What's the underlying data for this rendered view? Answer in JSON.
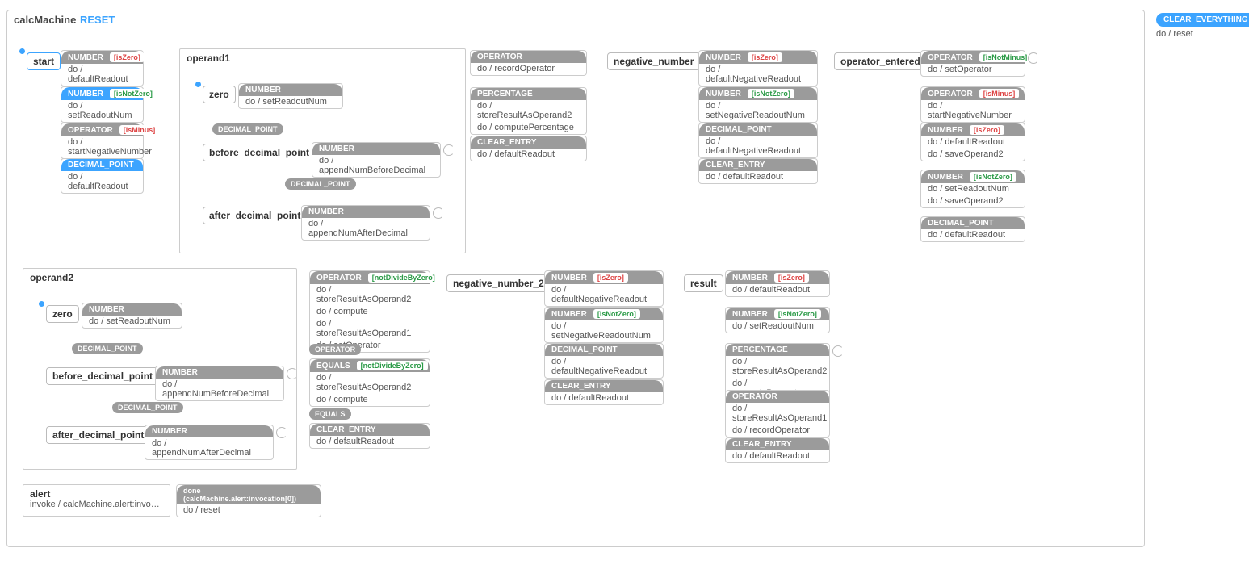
{
  "machine": {
    "title": "calcMachine",
    "reset": "RESET"
  },
  "global": {
    "clear": {
      "event": "CLEAR_EVERYTHING",
      "action": "do / reset"
    }
  },
  "states": {
    "start": "start",
    "operand1": "operand1",
    "operand2": "operand2",
    "negnum": "negative_number",
    "negnum2": "negative_number_2",
    "opent": "operator_entered",
    "result": "result",
    "alert": "alert",
    "zero": "zero",
    "bdp": "before_decimal_point",
    "adp": "after_decimal_point"
  },
  "ev": {
    "number": "NUMBER",
    "operator": "OPERATOR",
    "dp": "DECIMAL_POINT",
    "pct": "PERCENTAGE",
    "ce": "CLEAR_ENTRY",
    "eq": "EQUALS",
    "done": "done (calcMachine.alert:invocation[0])"
  },
  "guards": {
    "isZero": "[isZero]",
    "isNotZero": "[isNotZero]",
    "isMinus": "[isMinus]",
    "isNotMinus": "[isNotMinus]",
    "ndbz": "[notDivideByZero]"
  },
  "actions": {
    "defaultReadout": "do / defaultReadout",
    "setReadoutNum": "do / setReadoutNum",
    "startNegNum": "do / startNegativeNumber",
    "recordOperator": "do / recordOperator",
    "storeOp2": "do / storeResultAsOperand2",
    "storeOp1": "do / storeResultAsOperand1",
    "computePct": "do / computePercentage",
    "defNegReadout": "do / defaultNegativeReadout",
    "setNegReadoutNum": "do / setNegativeReadoutNum",
    "setOperator": "do / setOperator",
    "saveOp2": "do / saveOperand2",
    "appendBefore": "do / appendNumBeforeDecimal",
    "appendAfter": "do / appendNumAfterDecimal",
    "compute": "do / compute",
    "reset": "do / reset",
    "invoke": "invoke / calcMachine.alert:invocati…"
  }
}
